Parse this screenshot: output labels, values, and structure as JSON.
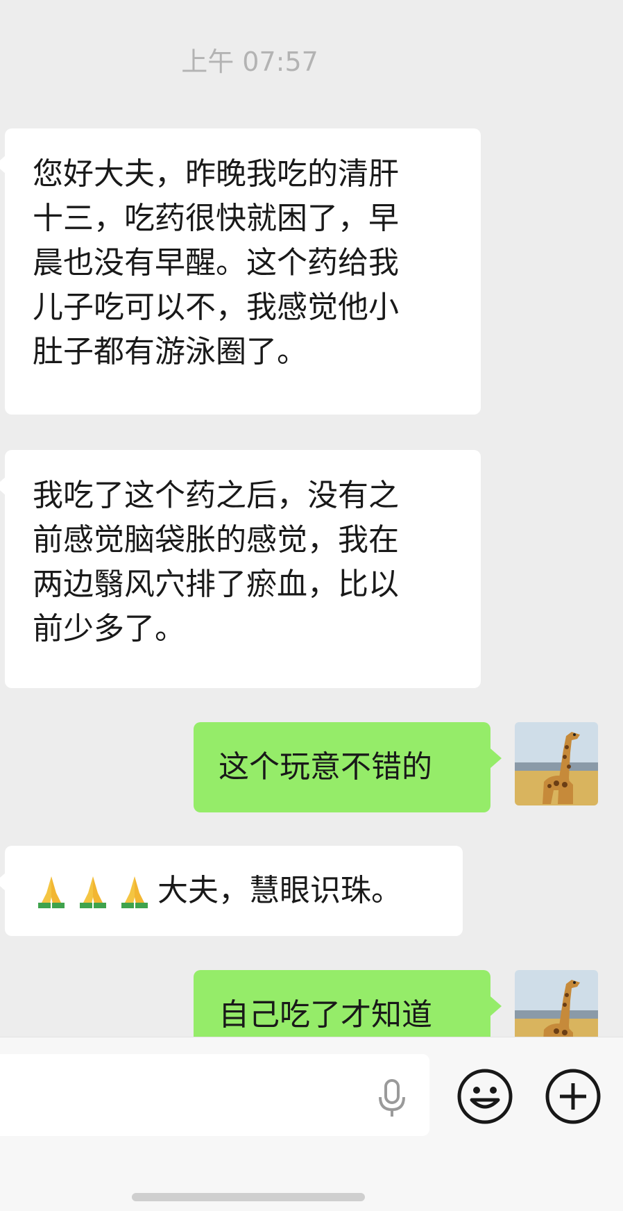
{
  "timestamp": "上午 07:57",
  "messages": [
    {
      "side": "in",
      "lines": [
        "您好大夫，昨晚我吃的清肝",
        "十三，吃药很快就困了，早",
        "晨也没有早醒。这个药给我",
        "儿子吃可以不，我感觉他小",
        "肚子都有游泳圈了。"
      ]
    },
    {
      "side": "in",
      "lines": [
        "我吃了这个药之后，没有之",
        "前感觉脑袋胀的感觉，我在",
        "两边翳风穴排了瘀血，比以",
        "前少多了。"
      ]
    },
    {
      "side": "out",
      "text": "这个玩意不错的"
    },
    {
      "side": "in",
      "emoji": [
        "🙏",
        "🙏",
        "🙏"
      ],
      "text": "大夫，慧眼识珠。"
    },
    {
      "side": "out",
      "text": "自己吃了才知道"
    }
  ],
  "colors": {
    "background": "#ededed",
    "incoming_bubble": "#ffffff",
    "outgoing_bubble": "#95ec69",
    "timestamp": "#b3b3b3"
  },
  "icons": [
    "folded-hands-emoji",
    "giraffe-avatar",
    "microphone-icon",
    "emoji-face-icon",
    "plus-circle-icon"
  ]
}
